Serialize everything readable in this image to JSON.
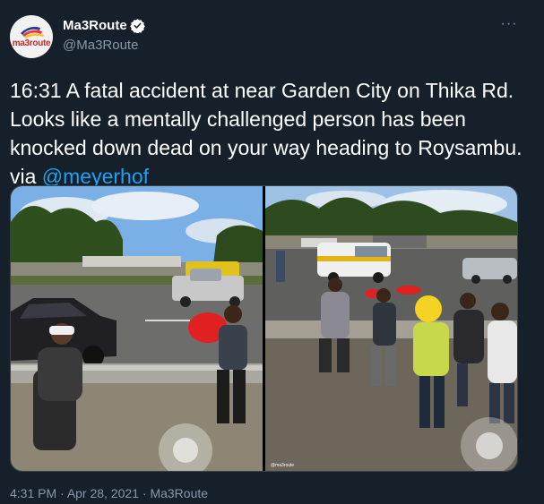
{
  "header": {
    "avatar_text": "ma3route",
    "display_name": "Ma3Route",
    "handle": "@Ma3Route",
    "more_label": "···",
    "verified_icon": "verified-badge-icon"
  },
  "tweet": {
    "text": "16:31 A fatal accident at near Garden City on Thika Rd. Looks like a mentally challenged person has been knocked down dead on your way heading to Roysambu.   via ",
    "mention": "@meyerhof_"
  },
  "media": {
    "right_watermark": "@ma3route"
  },
  "footer": {
    "time": "4:31 PM",
    "separator": " · ",
    "date": "Apr 28, 2021",
    "source": "Ma3Route"
  },
  "colors": {
    "background": "#15202b",
    "secondary_text": "#8899a6",
    "link": "#1da1f2",
    "verified": "#ffffff"
  }
}
